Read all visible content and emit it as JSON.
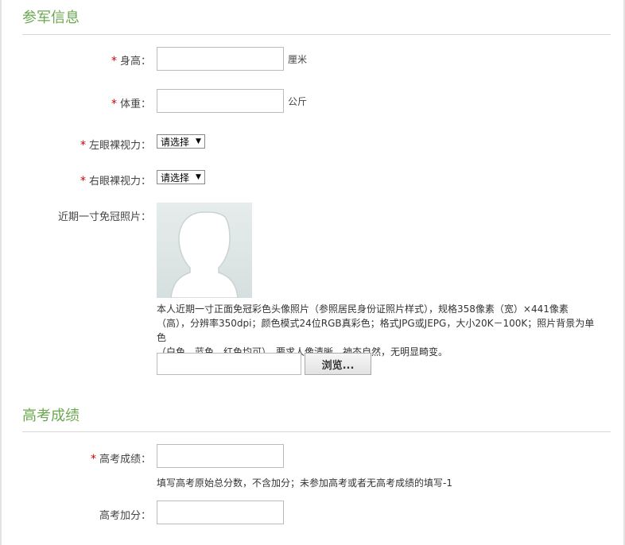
{
  "section1": {
    "title": "参军信息",
    "height": {
      "label": "身高：",
      "value": "",
      "unit": "厘米"
    },
    "weight": {
      "label": "体重：",
      "value": "",
      "unit": "公斤"
    },
    "left_eye": {
      "label": "左眼裸视力：",
      "selected": "请选择"
    },
    "right_eye": {
      "label": "右眼裸视力：",
      "selected": "请选择"
    },
    "photo": {
      "label": "近期一寸免冠照片：",
      "desc_line1": "本人近期一寸正面免冠彩色头像照片（参照居民身份证照片样式），规格358像素（宽）×441像素",
      "desc_line2": "（高），分辨率350dpi；颜色模式24位RGB真彩色；格式JPG或JEPG，大小20K－100K；照片背景为单色",
      "desc_line3": "（白色、蓝色、红色均可），要求人像清晰，神态自然，无明显畸变。",
      "browse_label": "浏览..."
    }
  },
  "section2": {
    "title": "高考成绩",
    "score": {
      "label": "高考成绩：",
      "value": "",
      "hint": "填写高考原始总分数，不含加分；未参加高考或者无高考成绩的填写-1"
    },
    "bonus": {
      "label": "高考加分：",
      "value": ""
    }
  },
  "required_mark": "*",
  "colors": {
    "accent": "#6aa84f",
    "required": "#cc0000"
  }
}
